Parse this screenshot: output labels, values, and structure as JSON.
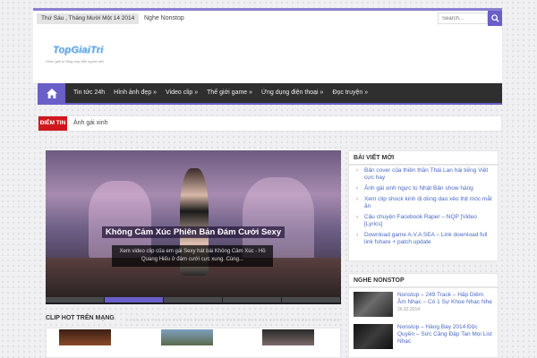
{
  "topbar": {
    "date": "Thứ Sáu , Tháng Mười Một 14 2014",
    "link": "Nghe Nonstop",
    "search_placeholder": "Search...",
    "accent": "#6a5fc9"
  },
  "header": {
    "logo": "TopGiaiTri",
    "tagline": "Kênh giải trí tổng hợp dẫn người việt"
  },
  "nav": {
    "items": [
      "Tin tức 24h",
      "Hình ảnh đẹp »",
      "Video clip »",
      "Thế giới game »",
      "Ứng dụng điện thoại »",
      "Đọc truyện »"
    ]
  },
  "breaking": {
    "label": "ĐIỂM TIN",
    "text": "Ảnh gái xinh",
    "color": "#d0171c"
  },
  "slider": {
    "title": "Không Cảm Xúc Phiên Bản Đám Cưới Sexy",
    "caption": "Xem video clip của em gái Sexy hát bài Không Cảm Xúc - Hồ Quang Hiếu ở đám cưới cực xung. Cùng...",
    "active_index": 1,
    "dot_count": 5
  },
  "recent": {
    "heading": "BÀI VIẾT MỚI",
    "items": [
      "Bản cover của thiên thần Thái Lan hài tiếng Việt cực hay",
      "Ảnh gái xinh ngực to Nhật Bản show hàng",
      "Xem clip shock kinh dị dùng dao xẻo thịt móc mắt ăn",
      "Câu chuyện Facebook Raper – NQP [Video [Lyrics]",
      "Download game A.V.A SEA – Link download full link fshare + patch update"
    ]
  },
  "nonstop": {
    "heading": "NGHE NONSTOP",
    "items": [
      {
        "title": "Nonstop – 249 Track – Hấp Diêm Âm Nhạc – Có 1 Sự Khoe Nhạc Nhẹ",
        "date": "26.02.2014"
      },
      {
        "title": "Nonstop – Hàng Bay 2014 Độc Quyền – Sức Căng Đập Tan Mọi List Nhạc",
        "date": ""
      }
    ]
  },
  "clips": {
    "heading": "CLIP HOT TRÊN MẠNG"
  }
}
